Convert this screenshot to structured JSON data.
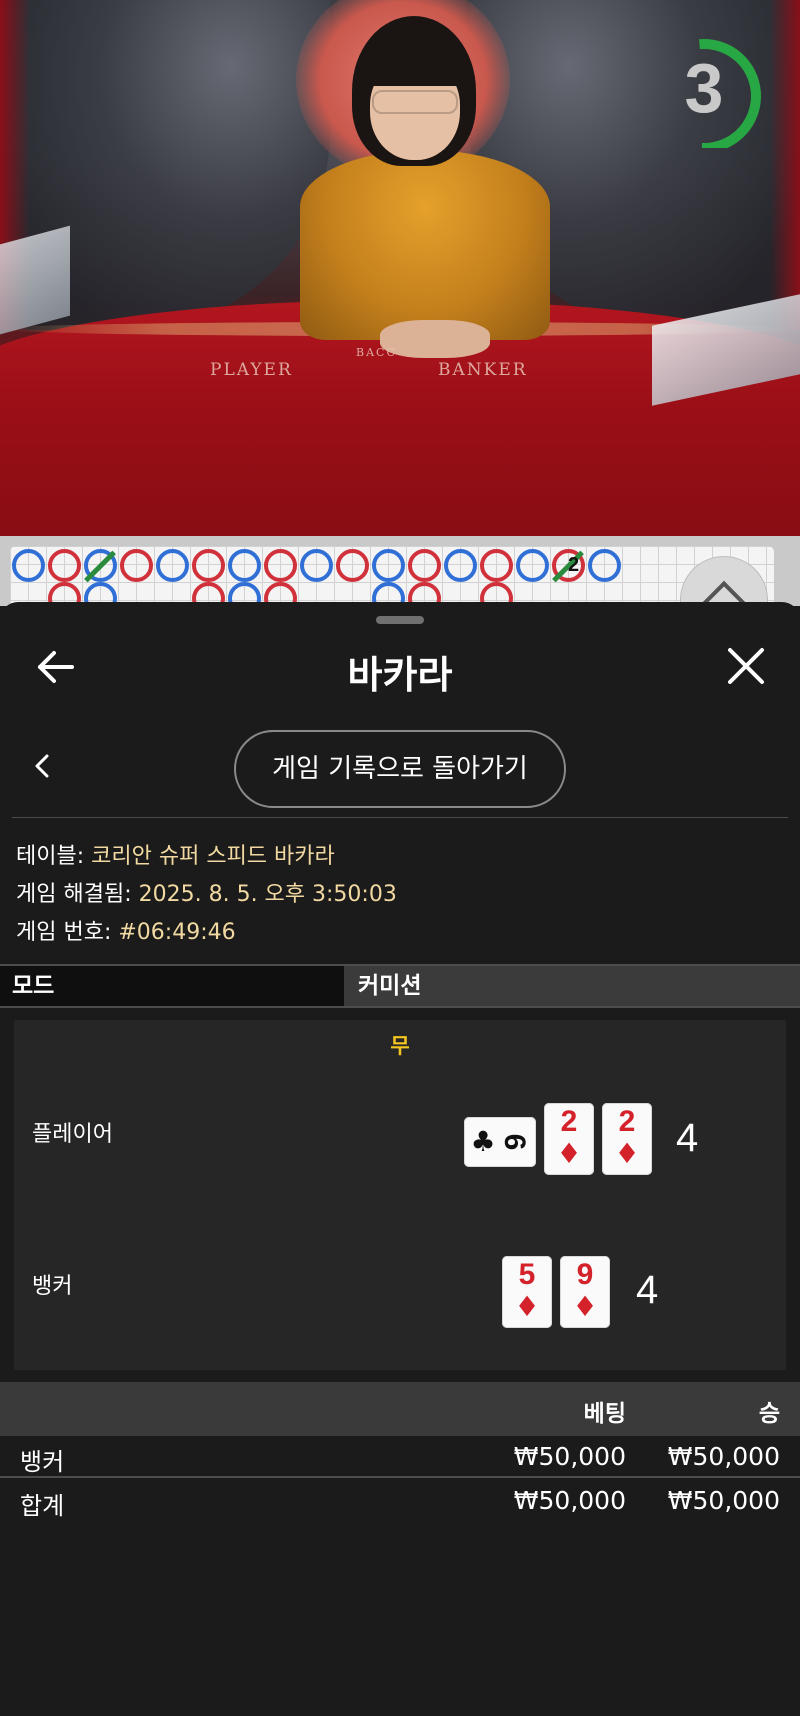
{
  "video": {
    "countdown": "3",
    "table_labels": {
      "player": "PLAYER",
      "banker": "BANKER",
      "small": "BACC"
    }
  },
  "roadmap": {
    "marks": [
      "2",
      "2"
    ]
  },
  "sheet": {
    "title": "바카라",
    "return_button": "게임 기록으로 돌아가기",
    "info": {
      "table_label": "테이블:",
      "table_value": "코리안 슈퍼 스피드 바카라",
      "resolved_label": "게임 해결됨:",
      "resolved_value": "2025. 8. 5. 오후 3:50:03",
      "number_label": "게임 번호:",
      "number_value": "#06:49:46"
    },
    "tabs": {
      "mode": "모드",
      "commission": "커미션"
    },
    "result": {
      "outcome": "무",
      "player": {
        "label": "플레이어",
        "cards": [
          {
            "rank": "6",
            "suit": "♣",
            "sideways": true
          },
          {
            "rank": "2",
            "suit": "♦"
          },
          {
            "rank": "2",
            "suit": "♦"
          }
        ],
        "score": "4"
      },
      "banker": {
        "label": "뱅커",
        "cards": [
          {
            "rank": "5",
            "suit": "♦"
          },
          {
            "rank": "9",
            "suit": "♦"
          }
        ],
        "score": "4"
      }
    },
    "bets": {
      "col_bet": "베팅",
      "col_win": "승",
      "rows": [
        {
          "label": "뱅커",
          "bet": "₩50,000",
          "win": "₩50,000"
        }
      ],
      "total": {
        "label": "합계",
        "bet": "₩50,000",
        "win": "₩50,000"
      }
    }
  },
  "colors": {
    "accent_value": "#f2d9a2",
    "outcome_tie": "#f4c521",
    "banker_ring": "#d0313a",
    "player_ring": "#2f6fd6",
    "tie_slash": "#2a8a3e",
    "countdown_arc": "#27a844"
  }
}
